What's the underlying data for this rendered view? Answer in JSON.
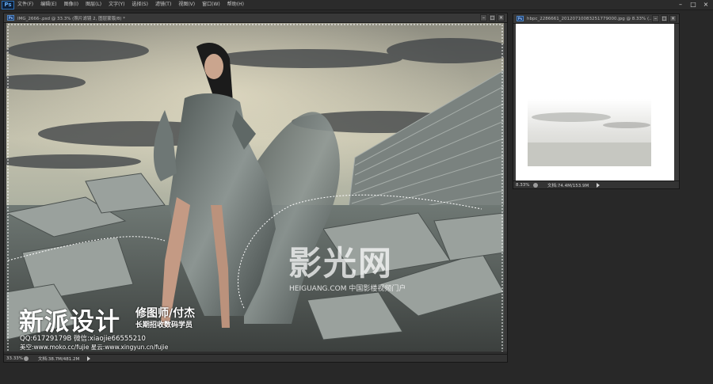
{
  "app": {
    "logo": "Ps",
    "menu": [
      "文件(F)",
      "编辑(E)",
      "图像(I)",
      "图层(L)",
      "文字(Y)",
      "选择(S)",
      "滤镜(T)",
      "视图(V)",
      "窗口(W)",
      "帮助(H)"
    ],
    "window_controls": {
      "minimize": "–",
      "restore": "□",
      "close": "×"
    }
  },
  "main_document": {
    "title": "IMG_2666-.psd @ 33.3% (照片滤镜 2, 图层蒙版/8) *",
    "zoom": "33.33%",
    "doc_info": "文档:38.7M/481.2M"
  },
  "second_document": {
    "title": "hbpc_2286661_20120710083251779000.jpg @ 8.33% (...",
    "zoom": "8.33%",
    "doc_info": "文档:74.4M/153.9M"
  },
  "watermark": {
    "big": "新派设计",
    "role": "修图师/付杰",
    "sub": "长期招收数码学员",
    "qq": "QQ:61729179B  微信:xiaojie66555210",
    "sites": "美空:www.moko.cc/fujie  星云:www.xingyun.cn/fujie"
  },
  "site_logo": {
    "big": "影光网",
    "sub": "HEIGUANG.COM 中国影楼视频门户"
  },
  "colors": {
    "chrome_dark": "#282828",
    "ps_blue": "#2e6fb4"
  }
}
